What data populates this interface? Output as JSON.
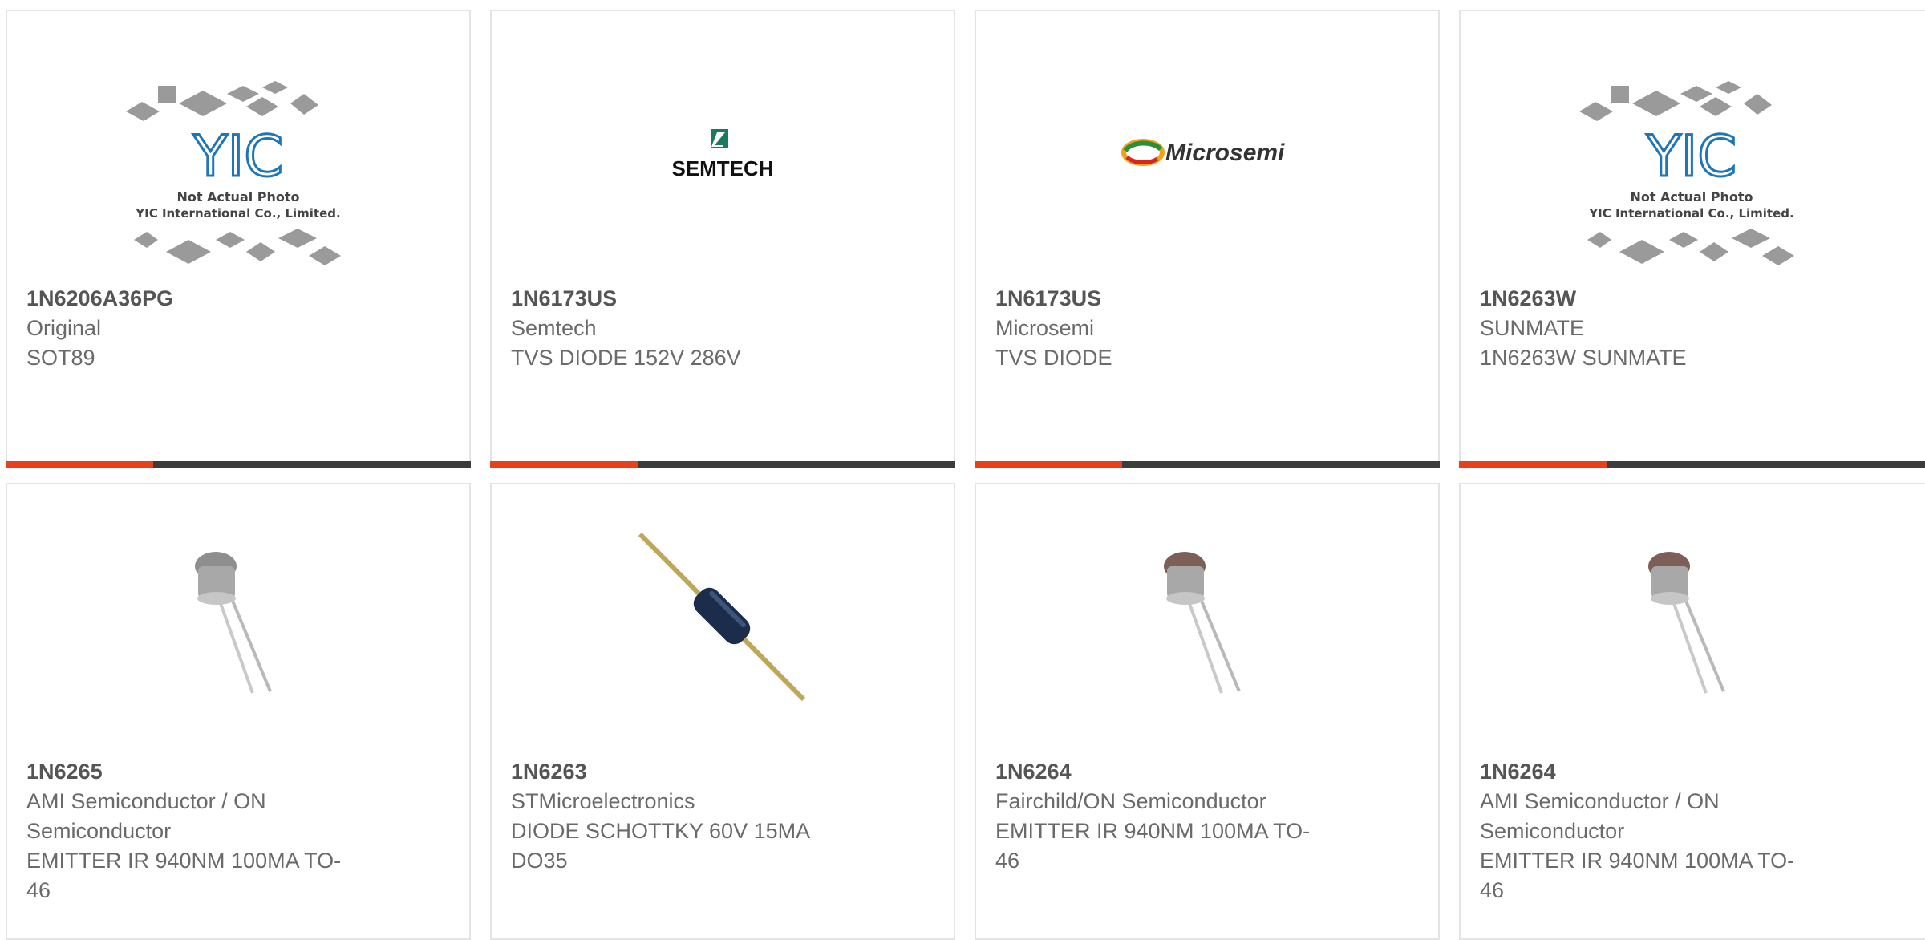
{
  "cards": [
    {
      "part": "1N6206A36PG",
      "maker": "Original",
      "desc": "SOT89",
      "image": "yic-placeholder",
      "placeholder_caption": [
        "Not Actual Photo",
        "YIC International Co., Limited."
      ],
      "logo_text": "YIC"
    },
    {
      "part": "1N6173US",
      "maker": "Semtech",
      "desc": "TVS DIODE 152V 286V",
      "image": "semtech-logo",
      "logo_text": "SEMTECH"
    },
    {
      "part": "1N6173US",
      "maker": "Microsemi",
      "desc": "TVS DIODE",
      "image": "microsemi-logo",
      "logo_text": "Microsemi"
    },
    {
      "part": "1N6263W",
      "maker": "SUNMATE",
      "desc": "1N6263W SUNMATE",
      "image": "yic-placeholder",
      "placeholder_caption": [
        "Not Actual Photo",
        "YIC International Co., Limited."
      ],
      "logo_text": "YIC"
    },
    {
      "part": "1N6265",
      "maker_lines": [
        "AMI Semiconductor / ON",
        "Semiconductor"
      ],
      "desc_lines": [
        "EMITTER IR 940NM 100MA TO-",
        "46"
      ],
      "image": "led-emitter"
    },
    {
      "part": "1N6263",
      "maker_lines": [
        "STMicroelectronics"
      ],
      "desc_lines": [
        "DIODE SCHOTTKY 60V 15MA",
        "DO35"
      ],
      "image": "axial-diode"
    },
    {
      "part": "1N6264",
      "maker_lines": [
        "Fairchild/ON Semiconductor"
      ],
      "desc_lines": [
        "EMITTER IR 940NM 100MA TO-",
        "46"
      ],
      "image": "led-emitter"
    },
    {
      "part": "1N6264",
      "maker_lines": [
        "AMI Semiconductor / ON",
        "Semiconductor"
      ],
      "desc_lines": [
        "EMITTER IR 940NM 100MA TO-",
        "46"
      ],
      "image": "led-emitter"
    }
  ],
  "colors": {
    "accent": "#e8401a",
    "bar": "#3c3c3c",
    "border": "#e4e4e4"
  }
}
